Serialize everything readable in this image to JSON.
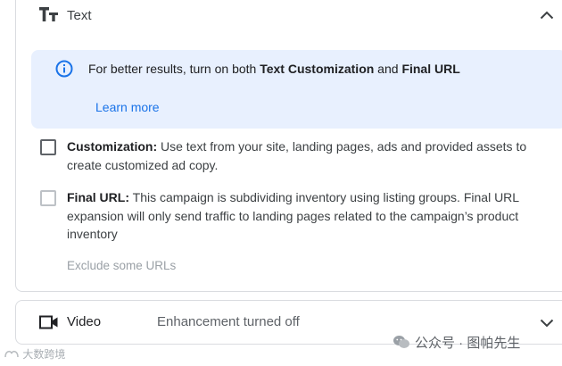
{
  "text_section": {
    "title": "Text",
    "icon": "text-format-icon",
    "expanded": true,
    "info": {
      "prefix": "For better results, turn on both ",
      "bold1": "Text Customization",
      "middle": " and ",
      "bold2": "Final URL",
      "link": "Learn more"
    },
    "customization": {
      "checked": false,
      "label": "Customization:",
      "description": " Use text from your site, landing pages, ads and provided assets to create customized ad copy."
    },
    "final_url": {
      "checked": false,
      "label": "Final URL:",
      "description": " This campaign is subdividing inventory using listing groups. Final URL expansion will only send traffic to landing pages related to the campaign’s product inventory"
    },
    "exclude_link": "Exclude some URLs"
  },
  "video_section": {
    "title": "Video",
    "icon": "video-camera-icon",
    "status": "Enhancement turned off",
    "expanded": false
  },
  "watermarks": {
    "left": "大数跨境",
    "right": "公众号 · 图帕先生"
  },
  "colors": {
    "accent": "#1a73e8",
    "info_bg": "#e8f0fe",
    "border": "#dadce0",
    "muted": "#9aa0a6"
  }
}
